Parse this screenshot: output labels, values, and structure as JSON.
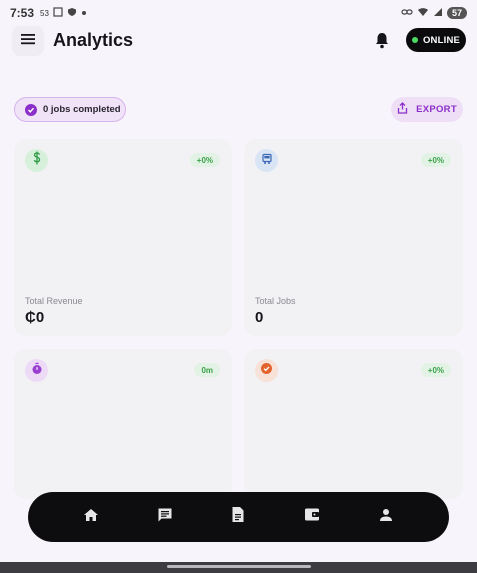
{
  "status_bar": {
    "time": "7:53",
    "notif_small": "53",
    "battery": "57"
  },
  "header": {
    "title": "Analytics",
    "online_label": "ONLINE"
  },
  "summary": {
    "jobs_completed": "0 jobs completed",
    "export_label": "EXPORT"
  },
  "cards": [
    {
      "label": "Total Revenue",
      "value": "₵0",
      "delta": "+0%",
      "icon": "dollar-icon",
      "icon_bg": "#d6f0dc",
      "icon_color": "#2e9b45"
    },
    {
      "label": "Total Jobs",
      "value": "0",
      "delta": "+0%",
      "icon": "truck-icon",
      "icon_bg": "#d9e4f5",
      "icon_color": "#3c69b5"
    },
    {
      "label": "",
      "value": "",
      "delta": "0m",
      "icon": "timer-icon",
      "icon_bg": "#eddaf7",
      "icon_color": "#9b3fd0"
    },
    {
      "label": "",
      "value": "",
      "delta": "+0%",
      "icon": "badge-check-icon",
      "icon_bg": "#f8e1d6",
      "icon_color": "#e2632d"
    }
  ],
  "nav": [
    "home-icon",
    "chat-icon",
    "document-icon",
    "wallet-icon",
    "person-icon"
  ],
  "colors": {
    "accent": "#8b2fc9",
    "online_dot": "#4cd964",
    "positive": "#3aa14a"
  }
}
